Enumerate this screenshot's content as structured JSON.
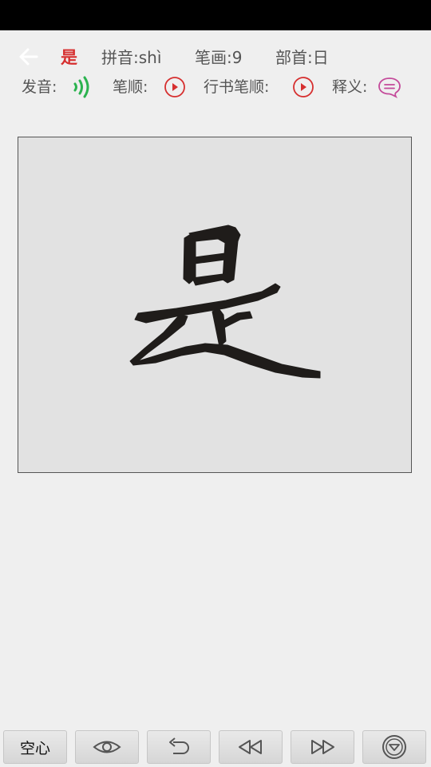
{
  "header": {
    "character": "是",
    "pinyin": "拼音:shì",
    "strokes": "笔画:9",
    "radical": "部首:日"
  },
  "controls": {
    "pronunciation_label": "发音:",
    "stroke_order_label": "笔顺:",
    "cursive_stroke_order_label": "行书笔顺:",
    "meaning_label": "释义:"
  },
  "display": {
    "character_glyph": "是"
  },
  "bottom_bar": {
    "hollow_label": "空心",
    "icons": [
      "eye-icon",
      "undo-icon",
      "rewind-icon",
      "fast-forward-icon",
      "menu-down-icon"
    ]
  },
  "colors": {
    "accent_red": "#d62f2f",
    "sound_green": "#2bb34f",
    "meaning_pink": "#c44a9a",
    "ink": "#1f1c1a"
  }
}
